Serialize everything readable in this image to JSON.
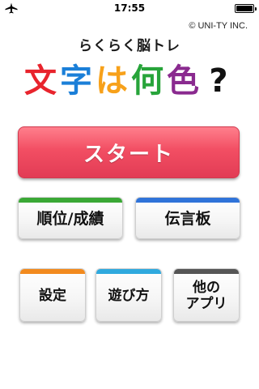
{
  "status_bar": {
    "time": "17:55",
    "airplane_icon": "airplane-icon",
    "battery_icon": "battery-icon"
  },
  "header": {
    "copyright": "© UNI-TY INC.",
    "subtitle": "らくらく脳トレ",
    "title_chars": [
      {
        "char": "文",
        "color": "#e8242d"
      },
      {
        "char": "字",
        "color": "#1b7fd8"
      },
      {
        "char": "は",
        "color": "#f7a11a"
      },
      {
        "char": "何",
        "color": "#27a43a"
      },
      {
        "char": "色",
        "color": "#8a2a8f"
      },
      {
        "char": "?",
        "color": "#111111"
      }
    ]
  },
  "buttons": {
    "start": {
      "label": "スタート"
    },
    "ranking": {
      "label": "順位/成績",
      "stripe_color": "#3aa835"
    },
    "board": {
      "label": "伝言板",
      "stripe_color": "#2f73d9"
    },
    "settings": {
      "label": "設定",
      "stripe_color": "#f28a1e"
    },
    "howto": {
      "label": "遊び方",
      "stripe_color": "#2fa9de"
    },
    "other_apps": {
      "label_line1": "他の",
      "label_line2": "アプリ",
      "stripe_color": "#555555"
    }
  }
}
